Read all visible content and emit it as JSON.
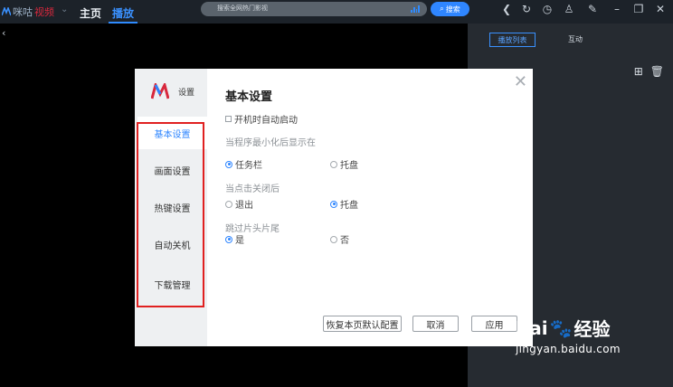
{
  "app": {
    "brand_prefix": "咪咕",
    "brand_suffix": "视频"
  },
  "nav": {
    "home": "主页",
    "play": "播放"
  },
  "search": {
    "placeholder": "搜索全网热门影视",
    "button": "搜索"
  },
  "toolbar": {
    "icons": [
      "back-icon",
      "refresh-icon",
      "history-icon",
      "user-icon",
      "pin-icon",
      "minimize-icon",
      "restore-icon",
      "close-icon"
    ]
  },
  "right_panel": {
    "tab_playlist": "播放列表",
    "tab_interact": "互动"
  },
  "dialog": {
    "logo_text": "设置",
    "sidebar": [
      "基本设置",
      "画面设置",
      "热键设置",
      "自动关机",
      "下载管理"
    ],
    "title": "基本设置",
    "autostart": {
      "label": "开机时自动启动",
      "checked": false
    },
    "minimize": {
      "question": "当程序最小化后显示在",
      "opt1": "任务栏",
      "opt2": "托盘",
      "selected": "任务栏"
    },
    "close": {
      "question": "当点击关闭后",
      "opt1": "退出",
      "opt2": "托盘",
      "selected": "托盘"
    },
    "skip": {
      "question": "跳过片头片尾",
      "opt1": "是",
      "opt2": "否",
      "selected": "是"
    },
    "buttons": {
      "restore": "恢复本页默认配置",
      "cancel": "取消",
      "apply": "应用"
    }
  },
  "watermark": {
    "brand_latin": "Bai",
    "brand_cn": "经验",
    "url": "jingyan.baidu.com"
  },
  "colors": {
    "accent": "#2f86ff",
    "highlight_box": "#e02020",
    "topbar": "#1c2229",
    "panel": "#262b31"
  }
}
